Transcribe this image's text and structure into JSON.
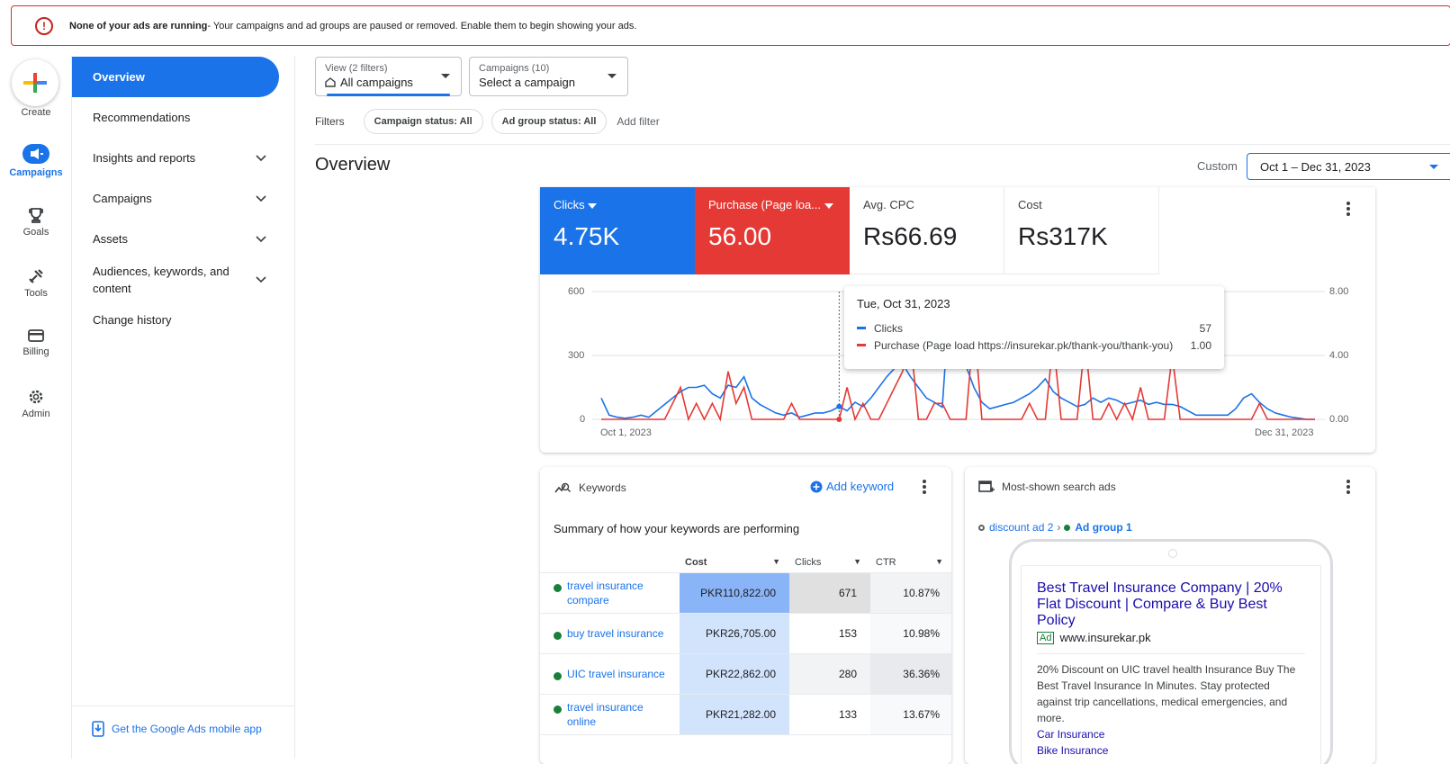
{
  "banner": {
    "bold": "None of your ads are running",
    "text": " - Your campaigns and ad groups are paused or removed. Enable them to begin showing your ads."
  },
  "rail": {
    "create": "Create",
    "campaigns": "Campaigns",
    "goals": "Goals",
    "tools": "Tools",
    "billing": "Billing",
    "admin": "Admin"
  },
  "nav": {
    "items": [
      {
        "label": "Overview"
      },
      {
        "label": "Recommendations"
      },
      {
        "label": "Insights and reports"
      },
      {
        "label": "Campaigns"
      },
      {
        "label": "Assets"
      },
      {
        "label": "Audiences, keywords, and content"
      },
      {
        "label": "Change history"
      }
    ],
    "mobile": "Get the Google Ads mobile app"
  },
  "view_dropdown": {
    "label": "View (2 filters)",
    "value": "All campaigns"
  },
  "campaign_dropdown": {
    "label": "Campaigns (10)",
    "value": "Select a campaign"
  },
  "filters": {
    "label": "Filters",
    "chips": [
      "Campaign status: All",
      "Ad group status: All"
    ],
    "add": "Add filter"
  },
  "page": {
    "title": "Overview",
    "custom": "Custom",
    "date_range": "Oct 1 – Dec 31, 2023"
  },
  "metrics": [
    {
      "label": "Clicks",
      "value": "4.75K"
    },
    {
      "label": "Purchase (Page loa...",
      "value": "56.00"
    },
    {
      "label": "Avg. CPC",
      "value": "Rs66.69"
    },
    {
      "label": "Cost",
      "value": "Rs317K"
    }
  ],
  "colors": {
    "blue": "#1a73e8",
    "red": "#e53935"
  },
  "chart_data": {
    "type": "line",
    "x_start": "Oct 1, 2023",
    "x_end": "Dec 31, 2023",
    "y_left_ticks": [
      "600",
      "300",
      "0"
    ],
    "y_right_ticks": [
      "8.00",
      "4.00",
      "0.00"
    ],
    "ylim_left": [
      0,
      600
    ],
    "ylim_right": [
      0,
      8
    ],
    "series": [
      {
        "name": "Clicks",
        "color": "#1a73e8",
        "axis": "left",
        "values": [
          100,
          20,
          10,
          5,
          10,
          20,
          10,
          40,
          70,
          100,
          130,
          150,
          150,
          160,
          120,
          100,
          160,
          150,
          200,
          100,
          70,
          50,
          30,
          20,
          30,
          10,
          20,
          30,
          30,
          40,
          60,
          40,
          80,
          60,
          100,
          150,
          200,
          240,
          260,
          200,
          150,
          100,
          80,
          57,
          600,
          400,
          250,
          150,
          80,
          50,
          60,
          70,
          80,
          100,
          120,
          150,
          190,
          130,
          100,
          80,
          60,
          70,
          100,
          80,
          100,
          90,
          70,
          80,
          90,
          70,
          80,
          70,
          70,
          60,
          40,
          20,
          20,
          20,
          20,
          20,
          50,
          100,
          120,
          80,
          50,
          30,
          20,
          10,
          5,
          0,
          0
        ]
      },
      {
        "name": "Purchase (Page load https://insurekar.pk/thank-you/thank-you)",
        "color": "#e53935",
        "axis": "right",
        "values": [
          0,
          0,
          0,
          0,
          0,
          0,
          0,
          0,
          0,
          1,
          2,
          0,
          1,
          0,
          1,
          0,
          3,
          1,
          2,
          0,
          0,
          0,
          0,
          0,
          1,
          0,
          0,
          0,
          0,
          0,
          0,
          2,
          0,
          1,
          0,
          0,
          1,
          2,
          3,
          5,
          0,
          0,
          1,
          1,
          0,
          0,
          0,
          6,
          0,
          0,
          0,
          0,
          0,
          0,
          1,
          0,
          0,
          5,
          0,
          0,
          0,
          5,
          0,
          0,
          1,
          0,
          1,
          0,
          2,
          0,
          0,
          0,
          4,
          0,
          0,
          0,
          0,
          0,
          0,
          0,
          0,
          0,
          0,
          1,
          0,
          0,
          0,
          0,
          0,
          0,
          0
        ]
      }
    ]
  },
  "tooltip": {
    "date": "Tue, Oct 31, 2023",
    "rows": [
      {
        "name": "Clicks",
        "value": "57"
      },
      {
        "name": "Purchase (Page load https://insurekar.pk/thank-you/thank-you)",
        "value": "1.00"
      }
    ]
  },
  "keywords": {
    "title": "Keywords",
    "add": "Add keyword",
    "summary": "Summary of how your keywords are performing",
    "columns": [
      "Cost",
      "Clicks",
      "CTR"
    ],
    "rows": [
      {
        "name": "travel insurance compare",
        "cost": "PKR110,822.00",
        "clicks": "671",
        "ctr": "10.87%"
      },
      {
        "name": "buy travel insurance",
        "cost": "PKR26,705.00",
        "clicks": "153",
        "ctr": "10.98%"
      },
      {
        "name": "UIC travel insurance",
        "cost": "PKR22,862.00",
        "clicks": "280",
        "ctr": "36.36%"
      },
      {
        "name": "travel insurance online",
        "cost": "PKR21,282.00",
        "clicks": "133",
        "ctr": "13.67%"
      }
    ]
  },
  "ads": {
    "title": "Most-shown search ads",
    "crumb_campaign": "discount ad 2",
    "crumb_sep": "›",
    "crumb_group": "Ad group 1",
    "headline": "Best Travel Insurance Company | 20% Flat Discount | Compare & Buy Best Policy",
    "ad_badge": "Ad",
    "url": "www.insurekar.pk",
    "description": "20% Discount on UIC travel health Insurance Buy The Best Travel Insurance In Minutes. Stay protected against trip cancellations, medical emergencies, and more.",
    "links": [
      "Car Insurance",
      "Bike Insurance"
    ]
  }
}
